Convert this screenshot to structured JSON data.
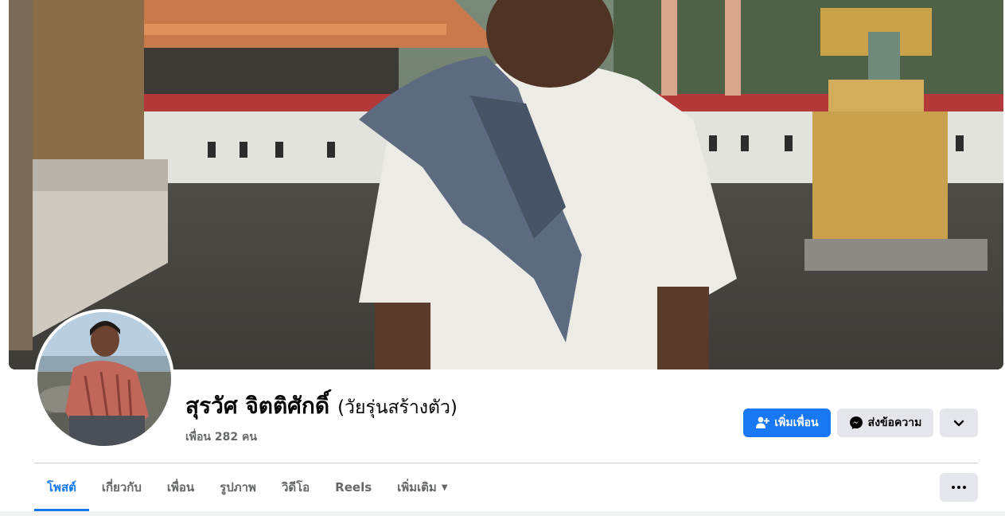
{
  "profile": {
    "name": "สุรวัศ จิตติศักดิ์",
    "alternate_name": "(วัยรุ่นสร้างตัว)",
    "friends_count": "เพื่อน 282 คน"
  },
  "actions": {
    "add_friend_label": "เพิ่มเพื่อน",
    "message_label": "ส่งข้อความ"
  },
  "tabs": [
    {
      "label": "โพสต์",
      "active": true
    },
    {
      "label": "เกี่ยวกับ",
      "active": false
    },
    {
      "label": "เพื่อน",
      "active": false
    },
    {
      "label": "รูปภาพ",
      "active": false
    },
    {
      "label": "วิดีโอ",
      "active": false
    },
    {
      "label": "Reels",
      "active": false
    },
    {
      "label": "เพิ่มเติม",
      "active": false
    }
  ],
  "icons": {
    "add_friend": "add-person-icon",
    "message": "messenger-icon",
    "dropdown": "chevron-down-icon",
    "more": "more-dots-icon",
    "tab_more_caret": "caret-down-icon"
  },
  "colors": {
    "accent": "#1877f2",
    "secondary_button": "#e4e6eb",
    "muted_text": "#65676b",
    "divider": "#ced0d4"
  }
}
